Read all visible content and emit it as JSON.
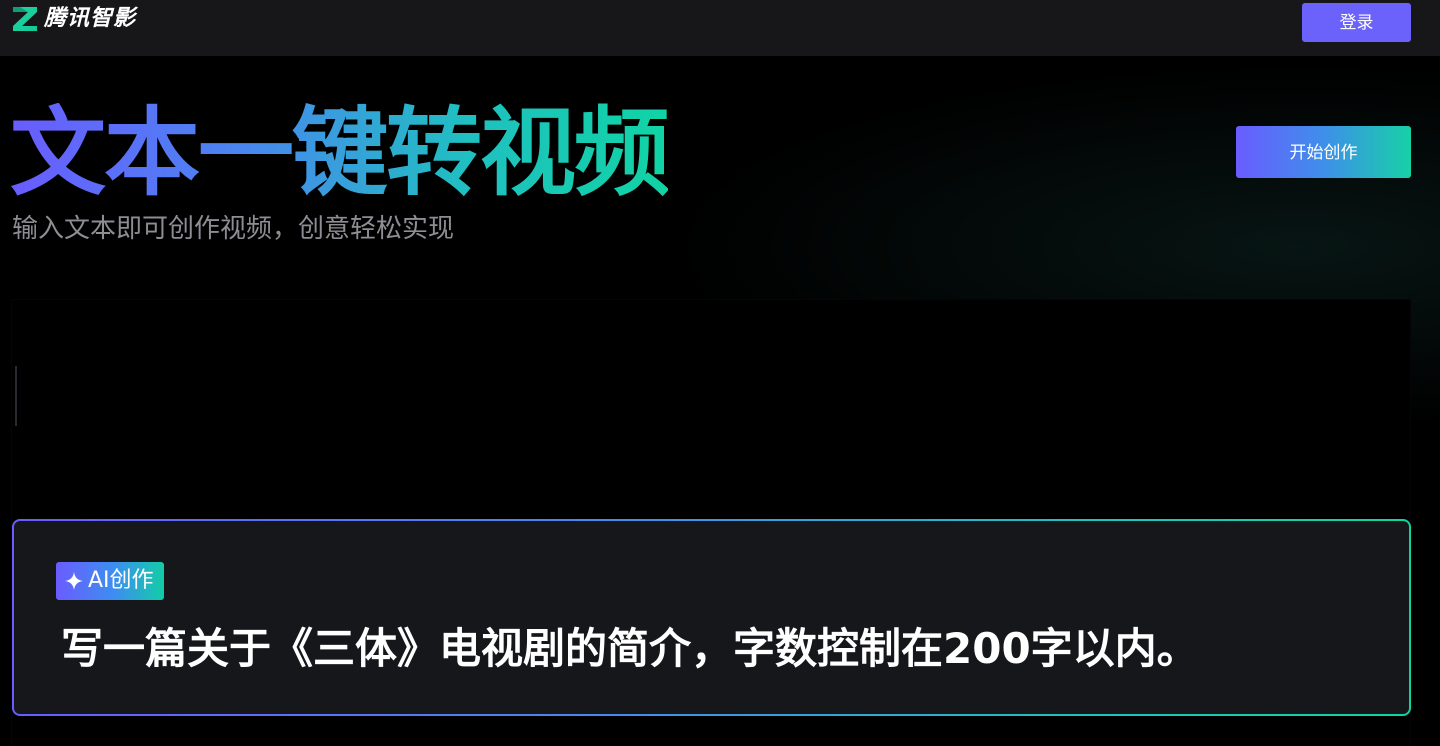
{
  "header": {
    "logo_text": "腾讯智影",
    "login_label": "登录"
  },
  "hero": {
    "title": "文本一键转视频",
    "subtitle": "输入文本即可创作视频，创意轻松实现",
    "start_label": "开始创作"
  },
  "prompt": {
    "badge_label": "AI创作",
    "text": "写一篇关于《三体》电视剧的简介，字数控制在200字以内。"
  },
  "colors": {
    "brand_purple": "#6a62fb",
    "brand_green": "#10d4a4",
    "topbar_bg": "#17171a",
    "card_bg": "#16171b"
  },
  "icons": {
    "logo": "tencent-zhiying-logo-icon",
    "badge": "sparkle-icon"
  }
}
